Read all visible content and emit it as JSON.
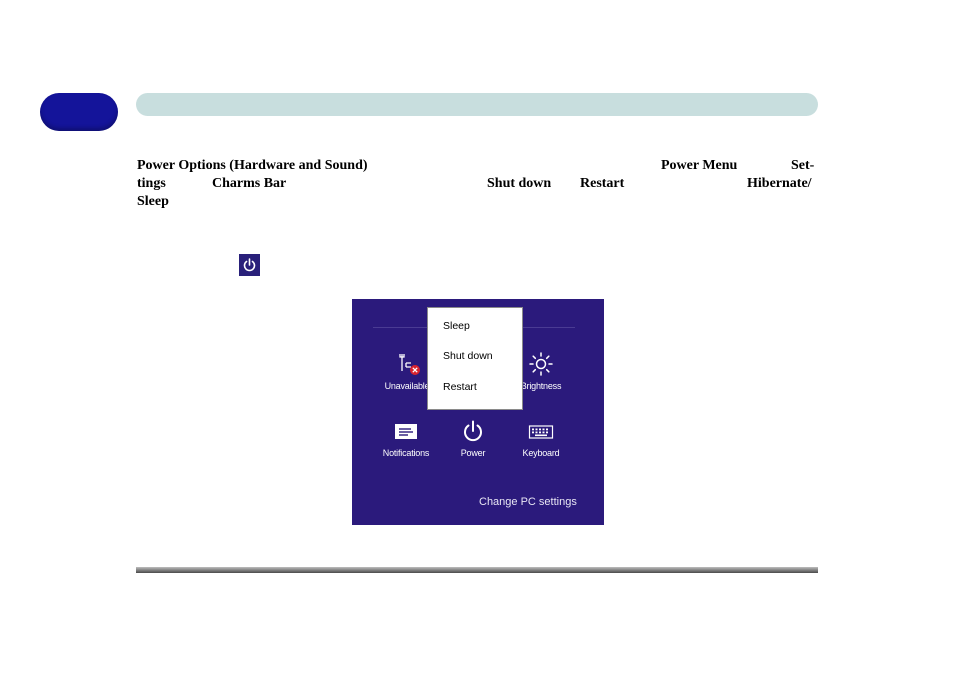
{
  "body": {
    "line1": {
      "power_options": "Power Options (Hardware and Sound)",
      "power_menu": "Power Menu",
      "settings_part1": "Set-"
    },
    "line2": {
      "settings_part2": "tings",
      "charms_bar": "Charms Bar",
      "shut_down": "Shut down",
      "restart": "Restart",
      "hibernate": "Hibernate/"
    },
    "line3": {
      "sleep": "Sleep"
    }
  },
  "screenshot": {
    "popup_items": [
      "Sleep",
      "Shut down",
      "Restart"
    ],
    "tiles": {
      "unavailable": "Unavailable",
      "brightness": "Brightness",
      "notifications": "Notifications",
      "power": "Power",
      "keyboard": "Keyboard"
    },
    "change_pc_settings": "Change PC settings",
    "background_color": "#2b1a7c"
  },
  "colors": {
    "chapter_tab": "#14149a",
    "header_bar": "#c8dede"
  }
}
